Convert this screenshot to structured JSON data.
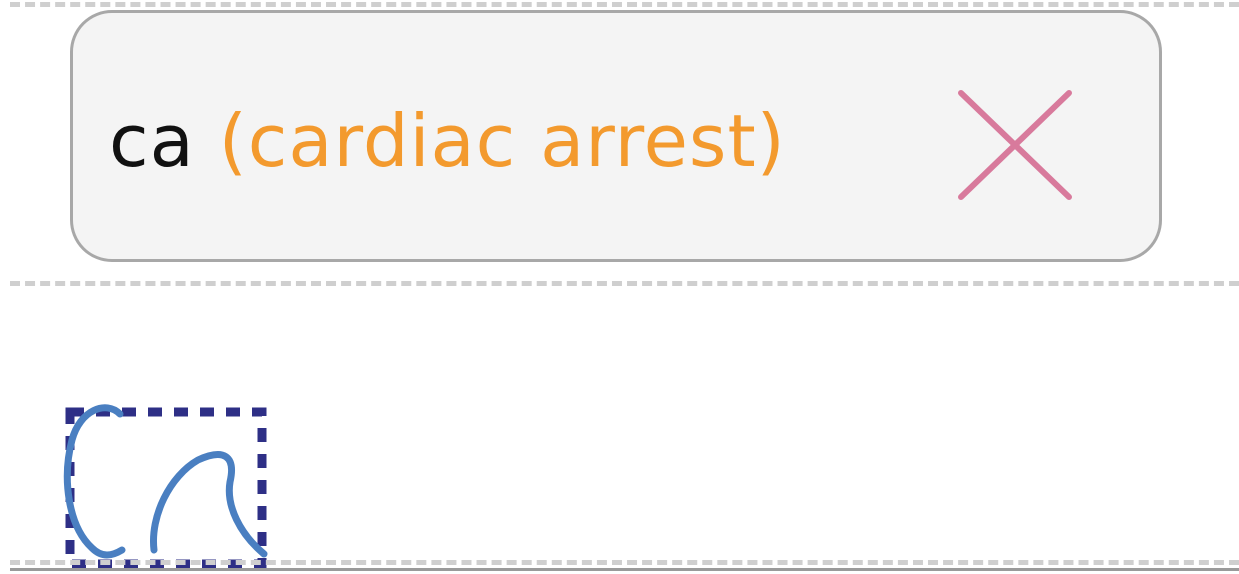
{
  "suggestion": {
    "abbreviation": "ca",
    "expansion": "(cardiac arrest)"
  },
  "icons": {
    "dismiss": "close-icon"
  },
  "colors": {
    "abbreviation": "#111111",
    "expansion": "#f39a2e",
    "dismiss": "#d87a9c",
    "ink": "#4a7fc1",
    "selection_box": "#2e2f86",
    "chip_background": "#f4f4f4",
    "chip_border": "#a8a8a8",
    "guide_line": "#cfcfcf"
  }
}
